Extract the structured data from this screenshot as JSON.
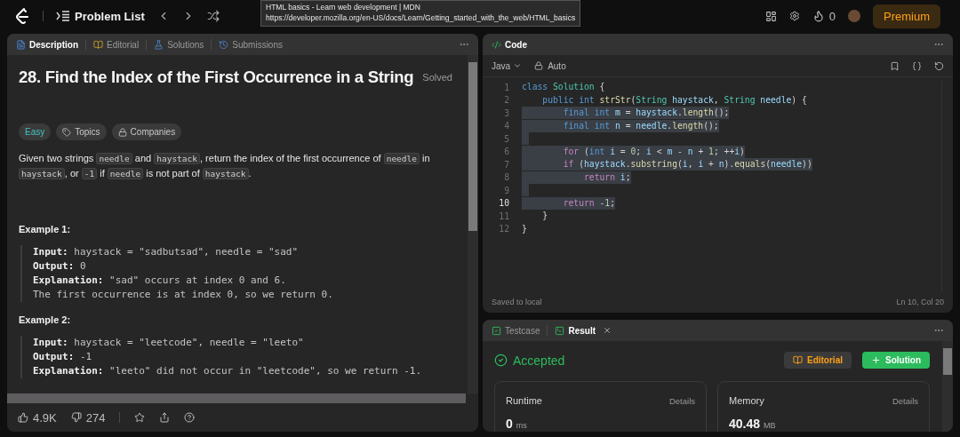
{
  "topbar": {
    "problem_list": "Problem List",
    "streak": "0",
    "premium": "Premium"
  },
  "tooltip": {
    "title": "HTML basics - Learn web development | MDN",
    "url": "https://developer.mozilla.org/en-US/docs/Learn/Getting_started_with_the_web/HTML_basics"
  },
  "description_panel": {
    "tabs": [
      {
        "label": "Description",
        "kind": "description",
        "selected": true
      },
      {
        "label": "Editorial",
        "kind": "editorial",
        "selected": false
      },
      {
        "label": "Solutions",
        "kind": "solutions",
        "selected": false
      },
      {
        "label": "Submissions",
        "kind": "submissions",
        "selected": false
      }
    ],
    "title": "28. Find the Index of the First Occurrence in a String",
    "status": "Solved",
    "tags": [
      {
        "label": "Easy",
        "kind": "difficulty"
      },
      {
        "label": "Topics",
        "kind": "topics"
      },
      {
        "label": "Companies",
        "kind": "companies"
      }
    ],
    "statement": [
      {
        "text": "Given two strings ",
        "code": false
      },
      {
        "text": "needle",
        "code": true
      },
      {
        "text": " and ",
        "code": false
      },
      {
        "text": "haystack",
        "code": true
      },
      {
        "text": ", return the index of the first occurrence of ",
        "code": false
      },
      {
        "text": "needle",
        "code": true
      },
      {
        "text": " in ",
        "code": false
      },
      {
        "text": "haystack",
        "code": true
      },
      {
        "text": ", or ",
        "code": false
      },
      {
        "text": "-1",
        "code": true
      },
      {
        "text": " if ",
        "code": false
      },
      {
        "text": "needle",
        "code": true
      },
      {
        "text": " is not part of ",
        "code": false
      },
      {
        "text": "haystack",
        "code": true
      },
      {
        "text": ".",
        "code": false
      }
    ],
    "examples": [
      {
        "heading": "Example 1:",
        "lines": [
          "**Input:** haystack = \"sadbutsad\", needle = \"sad\"",
          "**Output:** 0",
          "**Explanation:** \"sad\" occurs at index 0 and 6.",
          "The first occurrence is at index 0, so we return 0."
        ]
      },
      {
        "heading": "Example 2:",
        "lines": [
          "**Input:** haystack = \"leetcode\", needle = \"leeto\"",
          "**Output:** -1",
          "**Explanation:** \"leeto\" did not occur in \"leetcode\", so we return -1."
        ]
      }
    ],
    "likes": "4.9K",
    "dislikes": "274"
  },
  "code_panel": {
    "title": "Code",
    "language": "Java",
    "mode": "Auto",
    "lines": [
      {
        "number": "1",
        "current": false,
        "highlighted": false,
        "tokens": [
          {
            "kind": "keyword",
            "text": "class "
          },
          {
            "kind": "type",
            "text": "Solution"
          },
          {
            "kind": "plain",
            "text": " {"
          }
        ]
      },
      {
        "number": "2",
        "current": false,
        "highlighted": false,
        "tokens": [
          {
            "kind": "keyword",
            "text": "    public int "
          },
          {
            "kind": "function",
            "text": "strStr"
          },
          {
            "kind": "plain",
            "text": "("
          },
          {
            "kind": "type",
            "text": "String"
          },
          {
            "kind": "variable",
            "text": " haystack"
          },
          {
            "kind": "plain",
            "text": ", "
          },
          {
            "kind": "type",
            "text": "String"
          },
          {
            "kind": "variable",
            "text": " needle"
          },
          {
            "kind": "plain",
            "text": ") {"
          }
        ]
      },
      {
        "number": "3",
        "current": false,
        "highlighted": true,
        "tokens": [
          {
            "kind": "keyword",
            "text": "        final int "
          },
          {
            "kind": "variable",
            "text": "m"
          },
          {
            "kind": "plain",
            "text": " = "
          },
          {
            "kind": "variable",
            "text": "haystack"
          },
          {
            "kind": "plain",
            "text": "."
          },
          {
            "kind": "function",
            "text": "length"
          },
          {
            "kind": "plain",
            "text": "();"
          }
        ]
      },
      {
        "number": "4",
        "current": false,
        "highlighted": true,
        "tokens": [
          {
            "kind": "keyword",
            "text": "        final int "
          },
          {
            "kind": "variable",
            "text": "n"
          },
          {
            "kind": "plain",
            "text": " = "
          },
          {
            "kind": "variable",
            "text": "needle"
          },
          {
            "kind": "plain",
            "text": "."
          },
          {
            "kind": "function",
            "text": "length"
          },
          {
            "kind": "plain",
            "text": "();"
          }
        ]
      },
      {
        "number": "5",
        "current": false,
        "highlighted": true
      },
      {
        "number": "6",
        "current": false,
        "highlighted": true,
        "tokens": [
          {
            "kind": "control",
            "text": "        for"
          },
          {
            "kind": "plain",
            "text": " ("
          },
          {
            "kind": "keyword",
            "text": "int "
          },
          {
            "kind": "variable",
            "text": "i"
          },
          {
            "kind": "plain",
            "text": " = "
          },
          {
            "kind": "number",
            "text": "0"
          },
          {
            "kind": "plain",
            "text": "; "
          },
          {
            "kind": "variable",
            "text": "i"
          },
          {
            "kind": "plain",
            "text": " < "
          },
          {
            "kind": "variable",
            "text": "m"
          },
          {
            "kind": "plain",
            "text": " - "
          },
          {
            "kind": "variable",
            "text": "n"
          },
          {
            "kind": "plain",
            "text": " + "
          },
          {
            "kind": "number",
            "text": "1"
          },
          {
            "kind": "plain",
            "text": "; ++"
          },
          {
            "kind": "variable",
            "text": "i"
          },
          {
            "kind": "plain",
            "text": ")"
          }
        ]
      },
      {
        "number": "7",
        "current": false,
        "highlighted": true,
        "tokens": [
          {
            "kind": "control",
            "text": "        if"
          },
          {
            "kind": "plain",
            "text": " ("
          },
          {
            "kind": "variable",
            "text": "haystack"
          },
          {
            "kind": "plain",
            "text": "."
          },
          {
            "kind": "function",
            "text": "substring"
          },
          {
            "kind": "plain",
            "text": "("
          },
          {
            "kind": "variable",
            "text": "i"
          },
          {
            "kind": "plain",
            "text": ", "
          },
          {
            "kind": "variable",
            "text": "i"
          },
          {
            "kind": "plain",
            "text": " + "
          },
          {
            "kind": "variable",
            "text": "n"
          },
          {
            "kind": "plain",
            "text": ")."
          },
          {
            "kind": "function",
            "text": "equals"
          },
          {
            "kind": "plain",
            "text": "("
          },
          {
            "kind": "variable",
            "text": "needle"
          },
          {
            "kind": "plain",
            "text": "))"
          }
        ]
      },
      {
        "number": "8",
        "current": false,
        "highlighted": true,
        "tokens": [
          {
            "kind": "control",
            "text": "            return"
          },
          {
            "kind": "variable",
            "text": " i"
          },
          {
            "kind": "plain",
            "text": ";"
          }
        ]
      },
      {
        "number": "9",
        "current": false,
        "highlighted": true
      },
      {
        "number": "10",
        "current": true,
        "highlighted": true,
        "tokens": [
          {
            "kind": "control",
            "text": "        return"
          },
          {
            "kind": "plain",
            "text": " -"
          },
          {
            "kind": "number",
            "text": "1"
          },
          {
            "kind": "plain",
            "text": ";"
          }
        ]
      },
      {
        "number": "11",
        "current": false,
        "highlighted": false,
        "tokens": [
          {
            "kind": "plain",
            "text": "    }"
          }
        ]
      },
      {
        "number": "12",
        "current": false,
        "highlighted": false,
        "tokens": [
          {
            "kind": "plain",
            "text": "}"
          }
        ]
      }
    ],
    "saved": "Saved to local",
    "cursor": "Ln 10, Col 20"
  },
  "result_panel": {
    "tabs": [
      {
        "label": "Testcase",
        "kind": "testcase",
        "selected": false,
        "closable": false
      },
      {
        "label": "Result",
        "kind": "result",
        "selected": true,
        "closable": true
      }
    ],
    "verdict": "Accepted",
    "editorial_button": "Editorial",
    "solution_button": "Solution",
    "cards": [
      {
        "label": "Runtime",
        "details": "Details",
        "value": "0",
        "unit": "ms"
      },
      {
        "label": "Memory",
        "details": "Details",
        "value": "40.48",
        "unit": "MB"
      }
    ]
  }
}
